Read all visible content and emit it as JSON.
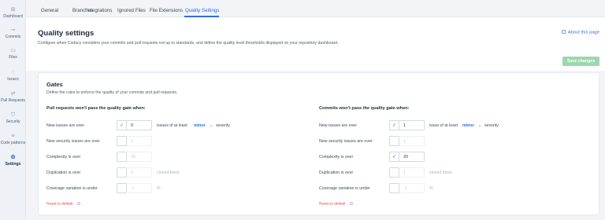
{
  "sidebar": {
    "items": [
      {
        "label": "Dashboard",
        "icon": "dashboard-icon",
        "glyph": "⊞"
      },
      {
        "label": "Commits",
        "icon": "commit-icon",
        "glyph": "⊸"
      },
      {
        "label": "Files",
        "icon": "file-icon",
        "glyph": "▭"
      },
      {
        "label": "Issues",
        "icon": "issue-icon",
        "glyph": "◌"
      },
      {
        "label": "Pull Requests",
        "icon": "pull-request-icon",
        "glyph": "⇄"
      },
      {
        "label": "Security",
        "icon": "shield-icon",
        "glyph": "⛉"
      },
      {
        "label": "Code patterns",
        "icon": "list-icon",
        "glyph": "≡"
      },
      {
        "label": "Settings",
        "icon": "gear-icon",
        "glyph": "⚙"
      }
    ],
    "active": "Settings"
  },
  "tabs": [
    "General",
    "Branches",
    "Integrations",
    "Ignored Files",
    "File Extensions",
    "Quality Settings"
  ],
  "active_tab": "Quality Settings",
  "header": {
    "title": "Quality settings",
    "description": "Configure when Codacy considers your commits and pull requests not up to standards, and define the quality level thresholds displayed on your repository dashboard.",
    "about_link": "About this page",
    "save_label": "Save changes"
  },
  "gates": {
    "title": "Gates",
    "description": "Define the rules to enforce the quality of your commits and pull requests.",
    "pull_requests": {
      "title": "Pull requests won't pass the quality gate when:",
      "new_issues": {
        "label": "New issues are over",
        "checked": true,
        "value": "0",
        "suffix": "issues of at least",
        "severity": "minor",
        "severity_suffix": "severity"
      },
      "security": {
        "label": "New security issues are over",
        "checked": false,
        "placeholder": "1"
      },
      "complexity": {
        "label": "Complexity is over",
        "checked": false,
        "placeholder": "20"
      },
      "duplication": {
        "label": "Duplication is over",
        "checked": false,
        "placeholder": "1",
        "suffix": "cloned block"
      },
      "coverage": {
        "label": "Coverage variation is under",
        "checked": false,
        "placeholder": "-1",
        "suffix": "%"
      },
      "reset": "Reset to default"
    },
    "commits": {
      "title": "Commits won't pass the quality gate when:",
      "new_issues": {
        "label": "New issues are over",
        "checked": true,
        "value": "1",
        "suffix": "issue of at least",
        "severity": "minor",
        "severity_suffix": "severity"
      },
      "security": {
        "label": "New security issues are over",
        "checked": false,
        "placeholder": "1"
      },
      "complexity": {
        "label": "Complexity is over",
        "checked": true,
        "value": "20"
      },
      "duplication": {
        "label": "Duplication is over",
        "checked": false,
        "placeholder": "1",
        "suffix": "cloned block"
      },
      "coverage": {
        "label": "Coverage variation is under",
        "checked": false,
        "placeholder": "-1",
        "suffix": "%"
      },
      "reset": "Reset to default"
    }
  },
  "colors": {
    "accent": "#2f6de1",
    "save_button": "#9bd8ac",
    "reset": "#e0392f"
  }
}
